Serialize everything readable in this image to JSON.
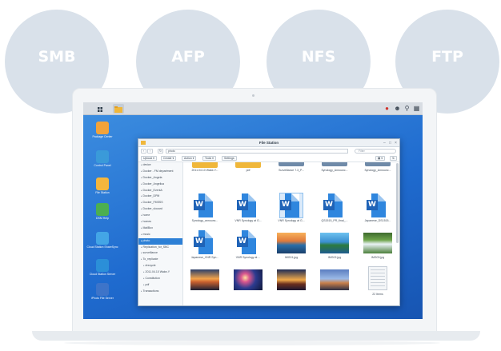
{
  "protocols": [
    "SMB",
    "AFP",
    "NFS",
    "FTP"
  ],
  "colors": {
    "circle": "#d9e1ea",
    "desktop": "#1f6bcf",
    "word_blue": "#2f86de",
    "selection": "#2d80d6",
    "folder": "#f0b73a"
  },
  "desktop_icons": [
    {
      "label": "Package Center",
      "icon": "package-center-icon",
      "color": "#f2a33a"
    },
    {
      "label": "Control Panel",
      "icon": "control-panel-icon",
      "color": "#3a9ad9"
    },
    {
      "label": "File Station",
      "icon": "file-station-icon",
      "color": "#f4b63d"
    },
    {
      "label": "DSM Help",
      "icon": "help-icon",
      "color": "#4caf50"
    },
    {
      "label": "Cloud Station ShareSync",
      "icon": "cloud-sync-icon",
      "color": "#43a5e6"
    },
    {
      "label": "Cloud Station Server",
      "icon": "cloud-server-icon",
      "color": "#2b8fd8"
    },
    {
      "label": "iPhoto File Server",
      "icon": "ftp-server-icon",
      "color": "#3d74c9"
    }
  ],
  "file_station": {
    "title": "File Station",
    "path": "photo",
    "search_placeholder": "Filter",
    "toolbar": {
      "upload": "Upload",
      "create": "Create",
      "action": "Action",
      "tools": "Tools",
      "settings": "Settings"
    },
    "tree": [
      {
        "label": "device",
        "sel": false,
        "indent": 1
      },
      {
        "label": "Docker - FM department",
        "sel": false,
        "indent": 1
      },
      {
        "label": "Docker_Angela",
        "sel": false,
        "indent": 1
      },
      {
        "label": "Docker_Angelica",
        "sel": false,
        "indent": 1
      },
      {
        "label": "Docker_EventA",
        "sel": false,
        "indent": 1
      },
      {
        "label": "Docker_DPM",
        "sel": false,
        "indent": 1
      },
      {
        "label": "Docker_FMSSS",
        "sel": false,
        "indent": 1
      },
      {
        "label": "Docker_vlocard",
        "sel": false,
        "indent": 1
      },
      {
        "label": "home",
        "sel": false,
        "indent": 1
      },
      {
        "label": "homes",
        "sel": false,
        "indent": 1
      },
      {
        "label": "MailBox",
        "sel": false,
        "indent": 1
      },
      {
        "label": "music",
        "sel": false,
        "indent": 1
      },
      {
        "label": "photo",
        "sel": true,
        "indent": 1
      },
      {
        "label": "Replication_for_SBC",
        "sel": false,
        "indent": 1
      },
      {
        "label": "surveillance",
        "sel": false,
        "indent": 1
      },
      {
        "label": "To_replicate",
        "sel": false,
        "indent": 1
      },
      {
        "label": "#recycle",
        "sel": false,
        "indent": 2
      },
      {
        "label": "2011.04.10 Wake-Y",
        "sel": false,
        "indent": 2
      },
      {
        "label": "Constitution",
        "sel": false,
        "indent": 2
      },
      {
        "label": "pdf",
        "sel": false,
        "indent": 2
      },
      {
        "label": "Transactions",
        "sel": false,
        "indent": 1
      }
    ],
    "files": [
      {
        "name": "2011.04.10 Wake-Y...",
        "kind": "folder"
      },
      {
        "name": "pdf",
        "kind": "folder"
      },
      {
        "name": "Surveillance 7.3_P...",
        "kind": "folder-sm"
      },
      {
        "name": "Synology_Announc...",
        "kind": "folder-sm"
      },
      {
        "name": "Synology_Announc...",
        "kind": "folder-sm"
      },
      {
        "name": "Synology_announc...",
        "kind": "word"
      },
      {
        "name": "VNR Synology at G...",
        "kind": "word"
      },
      {
        "name": "VNR Synology at G...",
        "kind": "word",
        "sel": true
      },
      {
        "name": "QS1515_PR_final_...",
        "kind": "word"
      },
      {
        "name": "Japanese_DS1515...",
        "kind": "word"
      },
      {
        "name": "Japanese_VNR Syn...",
        "kind": "word"
      },
      {
        "name": "VNR Synology at ...",
        "kind": "word"
      },
      {
        "name": "IMG01.jpg",
        "kind": "photo",
        "scene": "sea-sunset"
      },
      {
        "name": "IMG02.jpg",
        "kind": "photo",
        "scene": "lake"
      },
      {
        "name": "IMG03.jpg",
        "kind": "photo",
        "scene": "waterfall"
      },
      {
        "name": "",
        "kind": "photo",
        "scene": "dusk"
      },
      {
        "name": "",
        "kind": "photo",
        "scene": "fireworks"
      },
      {
        "name": "",
        "kind": "photo",
        "scene": "temple"
      },
      {
        "name": "",
        "kind": "photo",
        "scene": "city"
      },
      {
        "name": "22 Items",
        "kind": "text"
      }
    ]
  }
}
